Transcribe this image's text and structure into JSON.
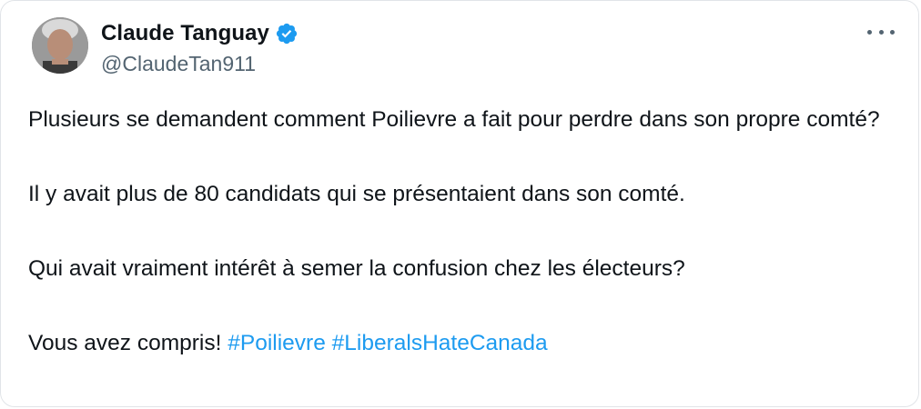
{
  "author": {
    "display_name": "Claude Tanguay",
    "handle": "@ClaudeTan911",
    "verified": true
  },
  "tweet": {
    "paragraph_1": "Plusieurs se demandent comment Poilievre a fait pour perdre dans son propre comté?",
    "paragraph_2": "Il y avait plus de 80 candidats qui se présentaient dans son comté.",
    "paragraph_3": "Qui avait vraiment intérêt à semer la confusion chez les électeurs?",
    "paragraph_4_text": "Vous avez compris!",
    "hashtags": [
      "#Poilievre",
      "#LiberalsHateCanada"
    ]
  },
  "icons": {
    "verified": "verified-badge-icon",
    "more": "more-options-icon"
  },
  "colors": {
    "hashtag": "#1d9bf0",
    "verified": "#1d9bf0",
    "secondary_text": "#536471",
    "primary_text": "#0f1419"
  }
}
